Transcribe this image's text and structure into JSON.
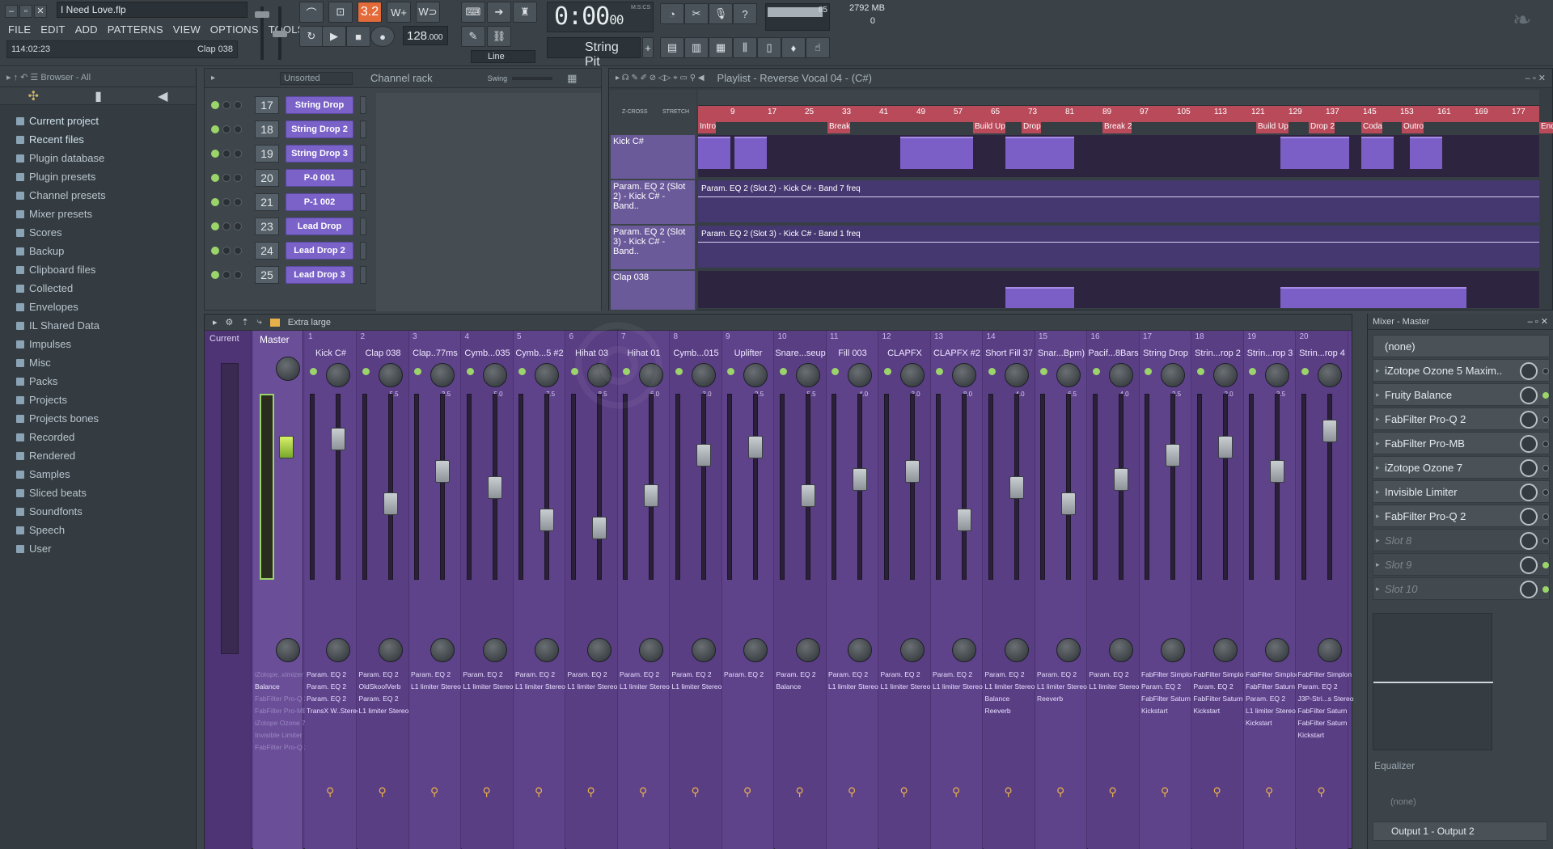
{
  "window": {
    "title": "I Need Love.flp"
  },
  "menu": [
    "FILE",
    "EDIT",
    "ADD",
    "PATTERNS",
    "VIEW",
    "OPTIONS",
    "TOOLS",
    "?"
  ],
  "hint": {
    "left": "114:02:23",
    "right": "Clap 038"
  },
  "transport": {
    "time": "0:00",
    "time_small": "00",
    "time_unit": "M:S:CS",
    "tempo": "128",
    "tempo_dec": ".000",
    "pattern_value": "3.2",
    "snap": "Line",
    "pattern": "String Pit",
    "cpu": "85",
    "mem": "2792 MB",
    "voices": "0"
  },
  "browser": {
    "header": "Browser - All",
    "items": [
      {
        "label": "Current project",
        "icon": "folder-icon"
      },
      {
        "label": "Recent files",
        "icon": "recent-icon"
      },
      {
        "label": "Plugin database",
        "icon": "plugin-icon"
      },
      {
        "label": "Plugin presets",
        "icon": "plugin-icon"
      },
      {
        "label": "Channel presets",
        "icon": "plugin-icon"
      },
      {
        "label": "Mixer presets",
        "icon": "mixer-icon"
      },
      {
        "label": "Scores",
        "icon": "note-icon"
      },
      {
        "label": "Backup",
        "icon": "folder-icon"
      },
      {
        "label": "Clipboard files",
        "icon": "folder-icon"
      },
      {
        "label": "Collected",
        "icon": "folder-icon"
      },
      {
        "label": "Envelopes",
        "icon": "folder-icon"
      },
      {
        "label": "IL Shared Data",
        "icon": "folder-icon"
      },
      {
        "label": "Impulses",
        "icon": "folder-icon"
      },
      {
        "label": "Misc",
        "icon": "folder-icon"
      },
      {
        "label": "Packs",
        "icon": "folder-icon"
      },
      {
        "label": "Projects",
        "icon": "folder-icon"
      },
      {
        "label": "Projects bones",
        "icon": "folder-icon"
      },
      {
        "label": "Recorded",
        "icon": "folder-icon"
      },
      {
        "label": "Rendered",
        "icon": "folder-icon"
      },
      {
        "label": "Samples",
        "icon": "folder-icon"
      },
      {
        "label": "Sliced beats",
        "icon": "folder-icon"
      },
      {
        "label": "Soundfonts",
        "icon": "folder-icon"
      },
      {
        "label": "Speech",
        "icon": "folder-icon"
      },
      {
        "label": "User",
        "icon": "user-icon"
      }
    ]
  },
  "channel_rack": {
    "title": "Channel rack",
    "group": "Unsorted",
    "swing": "Swing",
    "channels": [
      {
        "num": "17",
        "name": "String Drop"
      },
      {
        "num": "18",
        "name": "String Drop 2"
      },
      {
        "num": "19",
        "name": "String Drop 3"
      },
      {
        "num": "20",
        "name": "P-0 001"
      },
      {
        "num": "21",
        "name": "P-1 002"
      },
      {
        "num": "23",
        "name": "Lead Drop"
      },
      {
        "num": "24",
        "name": "Lead Drop 2"
      },
      {
        "num": "25",
        "name": "Lead Drop 3"
      }
    ]
  },
  "playlist": {
    "title": "Playlist - Reverse Vocal 04 - (C#)",
    "ruler": [
      "9",
      "17",
      "25",
      "33",
      "41",
      "49",
      "57",
      "65",
      "73",
      "81",
      "89",
      "97",
      "105",
      "113",
      "121",
      "129",
      "137",
      "145",
      "153",
      "161",
      "169",
      "177"
    ],
    "markers": [
      {
        "label": "Intro"
      },
      {
        "label": "Break"
      },
      {
        "label": "Build Up"
      },
      {
        "label": "Drop"
      },
      {
        "label": "Break 2"
      },
      {
        "label": "Build Up"
      },
      {
        "label": "Drop 2"
      },
      {
        "label": "Coda"
      },
      {
        "label": "Outro"
      },
      {
        "label": "End"
      }
    ],
    "tracks": [
      {
        "name": "Kick C#"
      },
      {
        "name": "Param. EQ 2 (Slot 2) - Kick C# - Band..",
        "clip": "Param. EQ 2 (Slot 2) - Kick C# - Band 7 freq"
      },
      {
        "name": "Param. EQ 2 (Slot 3) - Kick C# - Band..",
        "clip": "Param. EQ 2 (Slot 3) - Kick C# - Band 1 freq"
      },
      {
        "name": "Clap 038"
      }
    ],
    "zcross": "Z-CROSS",
    "stretch": "STRETCH"
  },
  "mixer": {
    "size": "Extra large",
    "current": "Current",
    "master": "Master",
    "master_fx": [
      "iZotope..ximizer",
      "Balance",
      "FabFilter Pro-Q 2",
      "FabFilter Pro-MB",
      "iZotope Ozone 7",
      "Invisible Limiter",
      "FabFilter Pro-Q 2"
    ],
    "strips": [
      {
        "num": "1",
        "name": "Kick C#",
        "pan": "",
        "fx": [
          "Param. EQ 2",
          "Param. EQ 2",
          "Param. EQ 2",
          "TransX W..Stereo"
        ]
      },
      {
        "num": "2",
        "name": "Clap 038",
        "pan": "5.5",
        "fx": [
          "Param. EQ 2",
          "OldSkoolVerb",
          "Param. EQ 2",
          "L1 limiter Stereo"
        ]
      },
      {
        "num": "3",
        "name": "Clap..77ms",
        "pan": "3.5",
        "fx": [
          "Param. EQ 2",
          "L1 limiter Stereo"
        ]
      },
      {
        "num": "4",
        "name": "Cymb...035",
        "pan": "5.0",
        "fx": [
          "Param. EQ 2",
          "L1 limiter Stereo"
        ]
      },
      {
        "num": "5",
        "name": "Cymb...5 #2",
        "pan": "7.5",
        "fx": [
          "Param. EQ 2",
          "L1 limiter Stereo"
        ]
      },
      {
        "num": "6",
        "name": "Hihat 03",
        "pan": "8.5",
        "fx": [
          "Param. EQ 2",
          "L1 limiter Stereo"
        ]
      },
      {
        "num": "7",
        "name": "Hihat 01",
        "pan": "6.0",
        "fx": [
          "Param. EQ 2",
          "L1 limiter Stereo"
        ]
      },
      {
        "num": "8",
        "name": "Cymb...015",
        "pan": "3.0",
        "fx": [
          "Param. EQ 2",
          "L1 limiter Stereo"
        ]
      },
      {
        "num": "9",
        "name": "Uplifter",
        "pan": "2.5",
        "fx": [
          "Param. EQ 2"
        ]
      },
      {
        "num": "10",
        "name": "Snare...seup",
        "pan": "5.5",
        "fx": [
          "Param. EQ 2",
          "Balance"
        ]
      },
      {
        "num": "11",
        "name": "Fill 003",
        "pan": "4.0",
        "fx": [
          "Param. EQ 2",
          "L1 limiter Stereo"
        ]
      },
      {
        "num": "12",
        "name": "CLAPFX",
        "pan": "3.0",
        "fx": [
          "Param. EQ 2",
          "L1 limiter Stereo"
        ]
      },
      {
        "num": "13",
        "name": "CLAPFX #2",
        "pan": "8.0",
        "fx": [
          "Param. EQ 2",
          "L1 limiter Stereo"
        ]
      },
      {
        "num": "14",
        "name": "Short Fill 37",
        "pan": "4.0",
        "fx": [
          "Param. EQ 2",
          "L1 limiter Stereo",
          "Balance",
          "Reeverb"
        ]
      },
      {
        "num": "15",
        "name": "Snar...Bpm)",
        "pan": "6.5",
        "fx": [
          "Param. EQ 2",
          "L1 limiter Stereo",
          "Reeverb"
        ]
      },
      {
        "num": "16",
        "name": "Pacif...8Bars",
        "pan": "4.0",
        "fx": [
          "Param. EQ 2",
          "L1 limiter Stereo"
        ]
      },
      {
        "num": "17",
        "name": "String Drop",
        "pan": "2.5",
        "fx": [
          "FabFilter Simplon",
          "Param. EQ 2",
          "FabFilter Saturn",
          "Kickstart"
        ]
      },
      {
        "num": "18",
        "name": "Strin...rop 2",
        "pan": "2.0",
        "fx": [
          "FabFilter Simplon",
          "Param. EQ 2",
          "FabFilter Saturn",
          "Kickstart"
        ]
      },
      {
        "num": "19",
        "name": "Strin...rop 3",
        "pan": "3.5",
        "fx": [
          "FabFilter Simplon",
          "FabFilter Saturn",
          "Param. EQ 2",
          "L1 limiter Stereo",
          "Kickstart"
        ]
      },
      {
        "num": "20",
        "name": "Strin...rop 4",
        "pan": "",
        "fx": [
          "FabFilter Simplon",
          "Param. EQ 2",
          "J3P-Stri...s Stereo",
          "FabFilter Saturn",
          "FabFilter Saturn",
          "Kickstart"
        ]
      }
    ]
  },
  "mixer_master_panel": {
    "title": "Mixer - Master",
    "preset": "(none)",
    "slots": [
      {
        "name": "iZotope Ozone 5 Maxim..",
        "empty": false,
        "on": false
      },
      {
        "name": "Fruity Balance",
        "empty": false,
        "on": true
      },
      {
        "name": "FabFilter Pro-Q 2",
        "empty": false,
        "on": false
      },
      {
        "name": "FabFilter Pro-MB",
        "empty": false,
        "on": false
      },
      {
        "name": "iZotope Ozone 7",
        "empty": false,
        "on": false
      },
      {
        "name": "Invisible Limiter",
        "empty": false,
        "on": false
      },
      {
        "name": "FabFilter Pro-Q 2",
        "empty": false,
        "on": false
      },
      {
        "name": "Slot 8",
        "empty": true,
        "on": false
      },
      {
        "name": "Slot 9",
        "empty": true,
        "on": true
      },
      {
        "name": "Slot 10",
        "empty": true,
        "on": true
      }
    ],
    "eq_label": "Equalizer",
    "send": "(none)",
    "output": "Output 1 - Output 2"
  },
  "colors": {
    "accent": "#7a62c9",
    "mixer_bg": "#5b3f86",
    "marker": "#b84a5a",
    "led_on": "#9bd46a"
  }
}
